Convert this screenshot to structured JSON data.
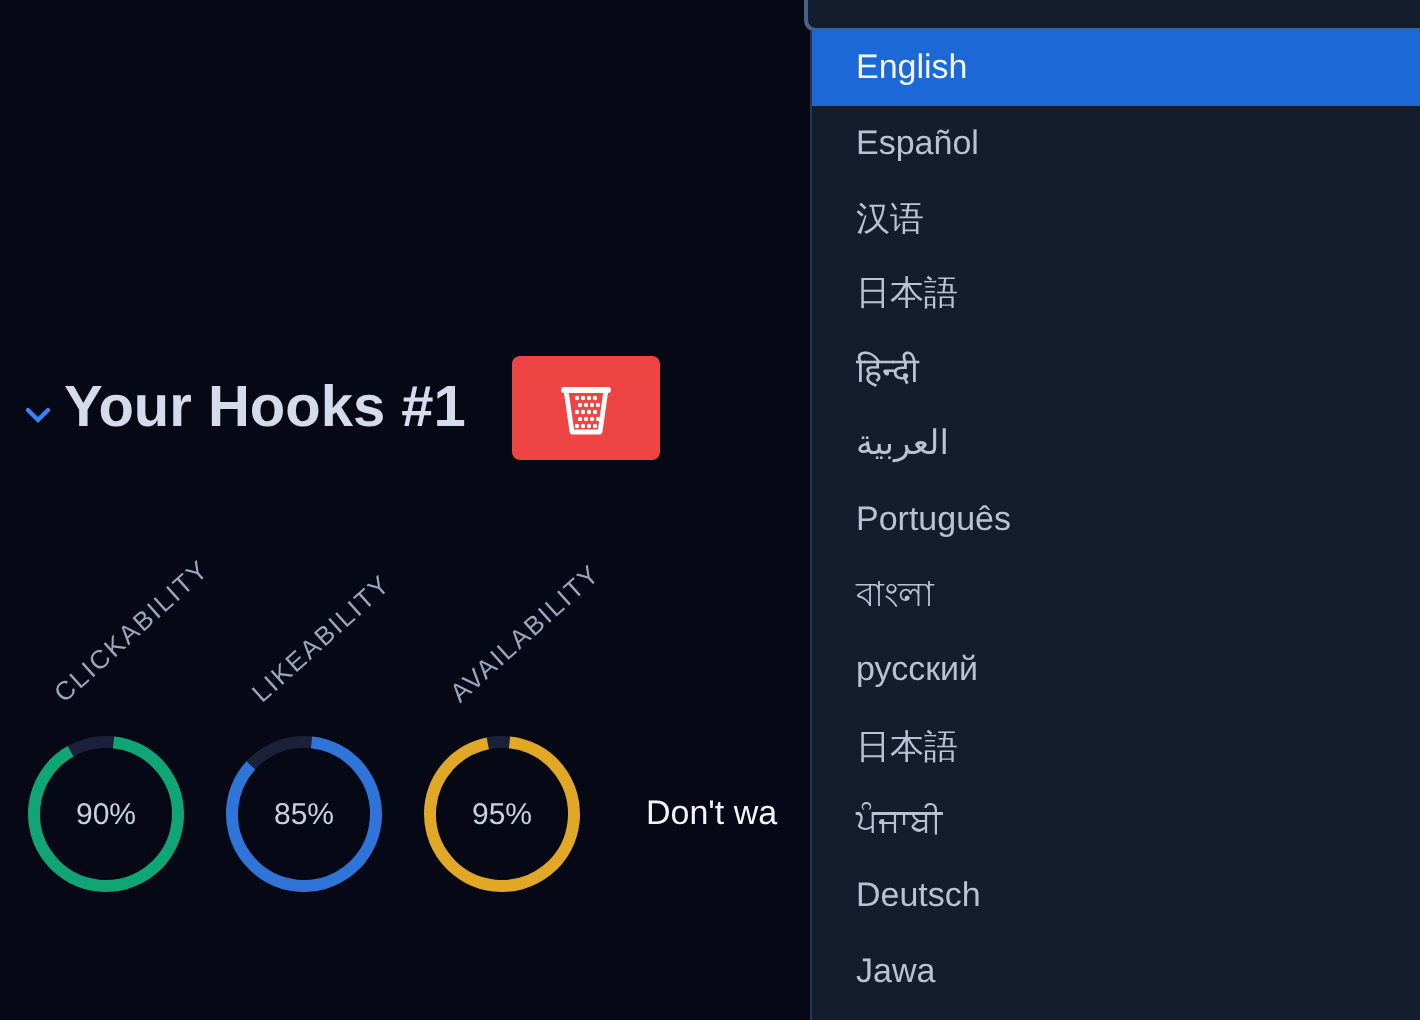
{
  "hook": {
    "title": "Your Hooks #1",
    "expanded": true,
    "metrics": [
      {
        "label": "CLICKABILITY",
        "reading": "90%",
        "level": 0.9,
        "color": "#10a574"
      },
      {
        "label": "LIKEABILITY",
        "reading": "85%",
        "level": 0.85,
        "color": "#2f74d8"
      },
      {
        "label": "AVAILABILITY",
        "reading": "95%",
        "level": 0.95,
        "color": "#e0a824"
      }
    ],
    "note": "Don't wa"
  },
  "language_select": {
    "expanded": true,
    "options": [
      {
        "label": "English",
        "selected": true
      },
      {
        "label": "Español",
        "selected": false
      },
      {
        "label": "汉语",
        "selected": false
      },
      {
        "label": "日本語",
        "selected": false
      },
      {
        "label": "हिन्दी",
        "selected": false
      },
      {
        "label": "العربية",
        "selected": false
      },
      {
        "label": "Português",
        "selected": false
      },
      {
        "label": "বাংলা",
        "selected": false
      },
      {
        "label": "русский",
        "selected": false
      },
      {
        "label": "日本語",
        "selected": false
      },
      {
        "label": "ਪੰਜਾਬੀ",
        "selected": false
      },
      {
        "label": "Deutsch",
        "selected": false
      },
      {
        "label": "Jawa",
        "selected": false
      }
    ]
  }
}
